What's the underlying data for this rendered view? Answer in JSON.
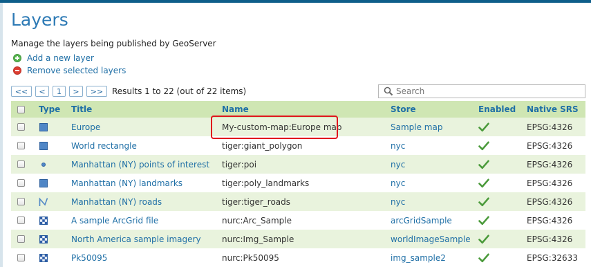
{
  "page": {
    "title": "Layers",
    "description": "Manage the layers being published by GeoServer"
  },
  "actions": {
    "add": "Add a new layer",
    "remove": "Remove selected layers"
  },
  "pager": {
    "first": "<<",
    "prev": "<",
    "page": "1",
    "next": ">",
    "last": ">>",
    "info": "Results 1 to 22 (out of 22 items)"
  },
  "search": {
    "placeholder": "Search",
    "value": ""
  },
  "table": {
    "headers": {
      "type": "Type",
      "title": "Title",
      "name": "Name",
      "store": "Store",
      "enabled": "Enabled",
      "srs": "Native SRS"
    },
    "rows": [
      {
        "type": "polygon",
        "title": "Europe",
        "name": "My-custom-map:Europe map",
        "store": "Sample map",
        "enabled": true,
        "srs": "EPSG:4326"
      },
      {
        "type": "polygon",
        "title": "World rectangle",
        "name": "tiger:giant_polygon",
        "store": "nyc",
        "enabled": true,
        "srs": "EPSG:4326"
      },
      {
        "type": "point",
        "title": "Manhattan (NY) points of interest",
        "name": "tiger:poi",
        "store": "nyc",
        "enabled": true,
        "srs": "EPSG:4326"
      },
      {
        "type": "polygon",
        "title": "Manhattan (NY) landmarks",
        "name": "tiger:poly_landmarks",
        "store": "nyc",
        "enabled": true,
        "srs": "EPSG:4326"
      },
      {
        "type": "line",
        "title": "Manhattan (NY) roads",
        "name": "tiger:tiger_roads",
        "store": "nyc",
        "enabled": true,
        "srs": "EPSG:4326"
      },
      {
        "type": "raster",
        "title": "A sample ArcGrid file",
        "name": "nurc:Arc_Sample",
        "store": "arcGridSample",
        "enabled": true,
        "srs": "EPSG:4326"
      },
      {
        "type": "raster",
        "title": "North America sample imagery",
        "name": "nurc:Img_Sample",
        "store": "worldImageSample",
        "enabled": true,
        "srs": "EPSG:4326"
      },
      {
        "type": "raster",
        "title": "Pk50095",
        "name": "nurc:Pk50095",
        "store": "img_sample2",
        "enabled": true,
        "srs": "EPSG:32633"
      }
    ]
  },
  "colors": {
    "accent": "#2d7ab5",
    "link": "#1f6fa6",
    "header_bg": "#cfe6b3",
    "row_alt_bg": "#e9f3dd",
    "highlight": "#e0141c",
    "check": "#4a9a3a"
  }
}
